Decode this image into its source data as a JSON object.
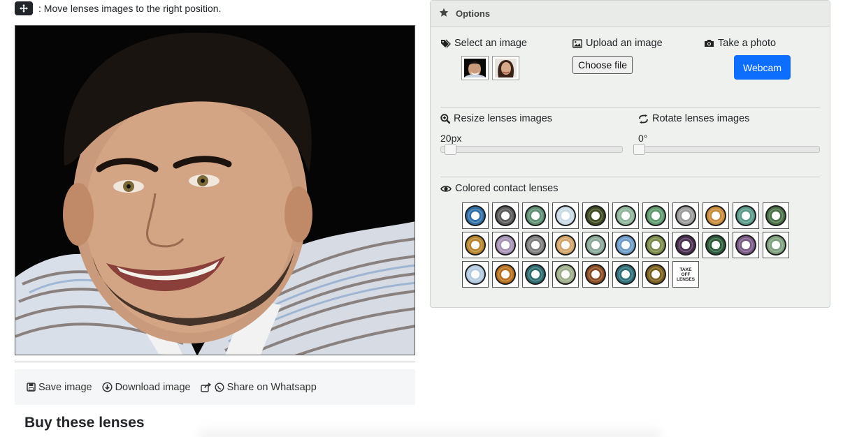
{
  "instruction": {
    "icon": "move-icon",
    "text": ": Move lenses images to the right position."
  },
  "actions": {
    "save": "Save image",
    "download": "Download image",
    "share": "Share on Whatsapp"
  },
  "buy_title": "Buy these lenses",
  "options": {
    "title": "Options",
    "select_image_label": "Select an image",
    "upload_image_label": "Upload an image",
    "choose_file_label": "Choose file",
    "take_photo_label": "Take a photo",
    "webcam_label": "Webcam",
    "resize_label": "Resize lenses images",
    "resize_value": "20px",
    "rotate_label": "Rotate lenses images",
    "rotate_value": "0°",
    "lenses_label": "Colored contact lenses",
    "take_off_label": "TAKE OFF LENSES"
  },
  "lens_colors": [
    [
      "#2f6fa6",
      "#5a5a5a",
      "#5f8f72",
      "#c9dbe6",
      "#3e4a22",
      "#8fb59b",
      "#5f9a6e",
      "#9a9a9a",
      "#c98a3c",
      "#5a9a8a",
      "#4a7048"
    ],
    [
      "#b8862e",
      "#a793b5",
      "#7e7e7e",
      "#d4a56b",
      "#8aa898",
      "#6d9cc8",
      "#7b8b4a",
      "#4a2e4f",
      "#2b5c3a",
      "#7a5a86",
      "#7fa07e"
    ],
    [
      "#b3cbe0",
      "#b8701e",
      "#2d6b6e",
      "#9fae8c",
      "#8a4a22",
      "#2d6e78",
      "#7a5e1e"
    ]
  ]
}
